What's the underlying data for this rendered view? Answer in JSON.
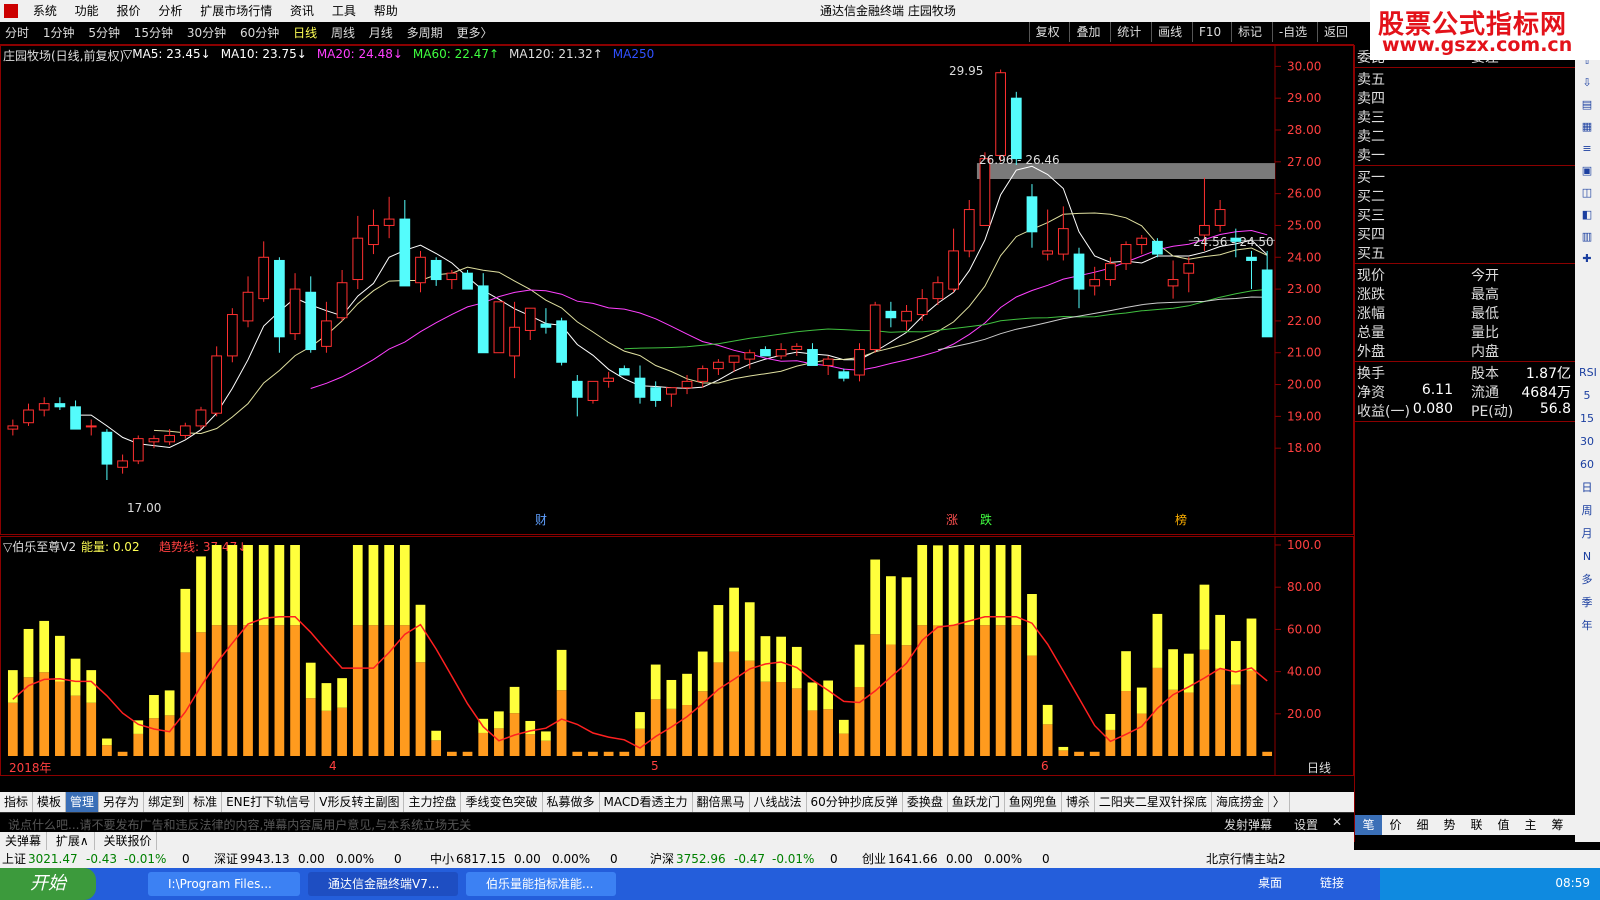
{
  "window": {
    "title": "通达信金融终端 庄园牧场"
  },
  "brand": {
    "line1": "股票公式指标网",
    "line2": "www.gszx.com.cn"
  },
  "menu": [
    "系统",
    "功能",
    "报价",
    "分析",
    "扩展市场行情",
    "资讯",
    "工具",
    "帮助"
  ],
  "periods": [
    "分时",
    "1分钟",
    "5分钟",
    "15分钟",
    "30分钟",
    "60分钟",
    "日线",
    "周线",
    "月线",
    "多周期",
    "更多〉"
  ],
  "active_period": "日线",
  "toolbar_right": [
    "复权",
    "叠加",
    "统计",
    "画线",
    "F10",
    "标记",
    "-自选",
    "返回"
  ],
  "main_chart": {
    "title": "庄园牧场(日线,前复权)",
    "ma_labels": [
      {
        "text": "▽MA5: 23.45↓",
        "color": "#ffffff"
      },
      {
        "text": "MA10: 23.75↓",
        "color": "#ffffff"
      },
      {
        "text": "MA20: 24.48↓",
        "color": "#ff40ff"
      },
      {
        "text": "MA60: 22.47↑",
        "color": "#40ff40"
      },
      {
        "text": "MA120: 21.32↑",
        "color": "#dddddd"
      },
      {
        "text": "MA250",
        "color": "#3050ff"
      }
    ],
    "y_ticks": [
      "30.00",
      "29.00",
      "28.00",
      "27.00",
      "26.00",
      "25.00",
      "24.00",
      "23.00",
      "22.00",
      "21.00",
      "20.00",
      "19.00",
      "18.00"
    ],
    "annotations": [
      "29.95",
      "26.96 - 26.46",
      "24.56 - 24.50",
      "17.00"
    ],
    "event_markers": [
      "财",
      "涨",
      "跌",
      "榜"
    ]
  },
  "sub_chart": {
    "title": "▽伯乐至尊V2",
    "energy_label": "能量: 0.02",
    "trend_label": "趋势线: 37.47↓",
    "y_ticks": [
      "100.0",
      "80.00",
      "60.00",
      "40.00",
      "20.00"
    ]
  },
  "x_axis": {
    "labels": [
      "2018年",
      "4",
      "5",
      "6"
    ],
    "period": "日线"
  },
  "chart_data": {
    "type": "candlestick",
    "title": "庄园牧场(日线,前复权)",
    "ylim": [
      17,
      30.2
    ],
    "candles": [
      [
        18.6,
        18.9,
        18.4,
        18.7
      ],
      [
        18.8,
        19.4,
        18.7,
        19.2
      ],
      [
        19.2,
        19.6,
        19.0,
        19.4
      ],
      [
        19.4,
        19.6,
        19.2,
        19.3
      ],
      [
        19.3,
        19.5,
        18.6,
        18.6
      ],
      [
        18.7,
        18.9,
        18.4,
        18.7
      ],
      [
        18.5,
        18.6,
        17.0,
        17.5
      ],
      [
        17.4,
        17.8,
        17.2,
        17.6
      ],
      [
        17.6,
        18.4,
        17.5,
        18.3
      ],
      [
        18.2,
        18.4,
        18.0,
        18.3
      ],
      [
        18.2,
        18.6,
        18.1,
        18.4
      ],
      [
        18.4,
        18.8,
        18.3,
        18.7
      ],
      [
        18.7,
        19.3,
        18.6,
        19.2
      ],
      [
        19.1,
        21.2,
        19.0,
        20.9
      ],
      [
        20.9,
        22.4,
        20.7,
        22.2
      ],
      [
        22.0,
        23.4,
        21.8,
        22.9
      ],
      [
        22.7,
        24.5,
        22.6,
        24.0
      ],
      [
        23.9,
        24.0,
        21.0,
        21.5
      ],
      [
        21.6,
        23.5,
        21.4,
        23.0
      ],
      [
        22.9,
        23.4,
        21.0,
        21.1
      ],
      [
        21.2,
        22.6,
        21.0,
        22.0
      ],
      [
        22.1,
        23.6,
        22.0,
        23.2
      ],
      [
        23.3,
        25.3,
        23.0,
        24.6
      ],
      [
        24.4,
        25.5,
        24.1,
        25.0
      ],
      [
        25.0,
        25.9,
        24.6,
        25.2
      ],
      [
        25.2,
        25.8,
        23.2,
        23.1
      ],
      [
        23.2,
        24.2,
        22.9,
        24.0
      ],
      [
        23.9,
        24.0,
        23.1,
        23.3
      ],
      [
        23.3,
        23.6,
        23.0,
        23.5
      ],
      [
        23.5,
        23.6,
        23.1,
        23.0
      ],
      [
        23.1,
        23.5,
        21.0,
        21.0
      ],
      [
        21.0,
        22.6,
        21.0,
        22.6
      ],
      [
        20.9,
        22.6,
        20.2,
        21.8
      ],
      [
        21.7,
        22.3,
        21.4,
        22.4
      ],
      [
        21.9,
        22.4,
        21.6,
        21.8
      ],
      [
        22.0,
        22.1,
        20.6,
        20.7
      ],
      [
        20.1,
        20.3,
        19.0,
        19.6
      ],
      [
        19.5,
        19.6,
        19.4,
        20.1
      ],
      [
        20.1,
        20.4,
        19.9,
        20.2
      ],
      [
        20.5,
        20.6,
        20.3,
        20.3
      ],
      [
        20.2,
        20.6,
        19.4,
        19.6
      ],
      [
        19.9,
        20.1,
        19.3,
        19.5
      ],
      [
        19.7,
        19.9,
        19.3,
        19.9
      ],
      [
        19.9,
        20.3,
        19.7,
        20.1
      ],
      [
        20.1,
        20.6,
        19.9,
        20.5
      ],
      [
        20.5,
        20.8,
        20.3,
        20.7
      ],
      [
        20.7,
        20.9,
        20.4,
        20.9
      ],
      [
        20.8,
        21.1,
        20.5,
        21.0
      ],
      [
        21.1,
        21.2,
        21.0,
        20.9
      ],
      [
        20.9,
        21.3,
        20.8,
        21.1
      ],
      [
        21.1,
        21.3,
        20.9,
        21.2
      ],
      [
        21.1,
        21.3,
        20.6,
        20.6
      ],
      [
        20.6,
        20.9,
        20.3,
        20.8
      ],
      [
        20.4,
        20.5,
        20.1,
        20.2
      ],
      [
        20.3,
        21.3,
        20.1,
        21.1
      ],
      [
        21.1,
        22.6,
        21.0,
        22.5
      ],
      [
        22.3,
        22.6,
        21.8,
        22.1
      ],
      [
        22.0,
        22.5,
        21.7,
        22.3
      ],
      [
        22.2,
        23.0,
        22.0,
        22.7
      ],
      [
        22.7,
        23.4,
        22.5,
        23.2
      ],
      [
        23.0,
        24.9,
        22.9,
        24.2
      ],
      [
        24.2,
        25.8,
        24.0,
        25.5
      ],
      [
        25.0,
        27.3,
        25.7,
        27.1
      ],
      [
        27.2,
        29.9,
        27.0,
        29.8
      ],
      [
        29.0,
        29.2,
        26.9,
        27.1
      ],
      [
        25.9,
        26.3,
        24.3,
        24.8
      ],
      [
        24.1,
        25.5,
        23.9,
        24.2
      ],
      [
        24.1,
        25.6,
        23.9,
        24.9
      ],
      [
        24.1,
        24.3,
        22.4,
        23.0
      ],
      [
        23.1,
        23.7,
        22.8,
        23.3
      ],
      [
        23.3,
        24.0,
        23.1,
        23.8
      ],
      [
        23.8,
        24.5,
        23.6,
        24.4
      ],
      [
        24.4,
        24.7,
        24.1,
        24.6
      ],
      [
        24.5,
        24.6,
        24.0,
        24.1
      ],
      [
        23.1,
        23.9,
        22.7,
        23.3
      ],
      [
        23.5,
        24.0,
        22.9,
        23.8
      ],
      [
        24.7,
        26.5,
        24.2,
        25.0
      ],
      [
        25.0,
        25.8,
        24.8,
        25.5
      ],
      [
        24.6,
        24.9,
        24.0,
        24.5
      ],
      [
        24.0,
        24.2,
        23.0,
        23.9
      ],
      [
        23.6,
        24.2,
        22.3,
        21.5
      ]
    ]
  },
  "quote_panel": {
    "header": [
      "委比",
      "委差"
    ],
    "sell": [
      "卖五",
      "卖四",
      "卖三",
      "卖二",
      "卖一"
    ],
    "buy": [
      "买一",
      "买二",
      "买三",
      "买四",
      "买五"
    ],
    "stats_left": [
      "现价",
      "涨跌",
      "涨幅",
      "总量",
      "外盘"
    ],
    "stats_right": [
      "今开",
      "最高",
      "最低",
      "量比",
      "内盘"
    ],
    "fund": [
      {
        "k1": "换手",
        "v1": "",
        "k2": "股本",
        "v2": "1.87亿"
      },
      {
        "k1": "净资",
        "v1": "6.11",
        "k2": "流通",
        "v2": "4684万"
      },
      {
        "k1": "收益(一)",
        "v1": "0.080",
        "k2": "PE(动)",
        "v2": "56.8"
      }
    ]
  },
  "indicator_tabs": [
    "指标",
    "模板",
    "管理",
    "另存为",
    "绑定到",
    "标准",
    "ENE打下轨信号",
    "V形反转主副图",
    "主力控盘",
    "季线变色突破",
    "私募做多",
    "MACD看透主力",
    "翻倍黑马",
    "八线战法",
    "60分钟抄底反弹",
    "委换盘",
    "鱼跃龙门",
    "鱼网兜鱼",
    "博杀",
    "二阳夹二星双针探底",
    "海底捞金",
    "〉"
  ],
  "active_tab": "管理",
  "danmu": {
    "placeholder": "说点什么吧...请不要发布广告和违反法律的内容,弹幕内容属用户意见,与本系统立场无关",
    "send": "发射弹幕",
    "settings": "设置"
  },
  "bottom_tabs": [
    "关弹幕",
    "扩展∧",
    "关联报价"
  ],
  "quote_tabs": [
    "笔",
    "价",
    "细",
    "势",
    "联",
    "值",
    "主",
    "筹"
  ],
  "status": [
    {
      "name": "上证",
      "val": "3021.47",
      "chg": "-0.43",
      "pct": "-0.01%",
      "vol": "0"
    },
    {
      "name": "深证",
      "val": "9943.13",
      "chg": "0.00",
      "pct": "0.00%",
      "vol": "0"
    },
    {
      "name": "中小",
      "val": "6817.15",
      "chg": "0.00",
      "pct": "0.00%",
      "vol": "0"
    },
    {
      "name": "沪深",
      "val": "3752.96",
      "chg": "-0.47",
      "pct": "-0.01%",
      "vol": "0"
    },
    {
      "name": "创业",
      "val": "1641.66",
      "chg": "0.00",
      "pct": "0.00%",
      "vol": "0"
    }
  ],
  "server": "北京行情主站2",
  "taskbar": {
    "start": "开始",
    "tasks": [
      "I:\\Program Files...",
      "通达信金融终端V7...",
      "伯乐量能指标准能..."
    ],
    "desktop": "桌面",
    "links": "链接",
    "time": "08:59"
  },
  "side_icons": [
    "RSI",
    "5",
    "15",
    "30",
    "60",
    "日",
    "周",
    "月",
    "N",
    "多",
    "季",
    "年"
  ]
}
